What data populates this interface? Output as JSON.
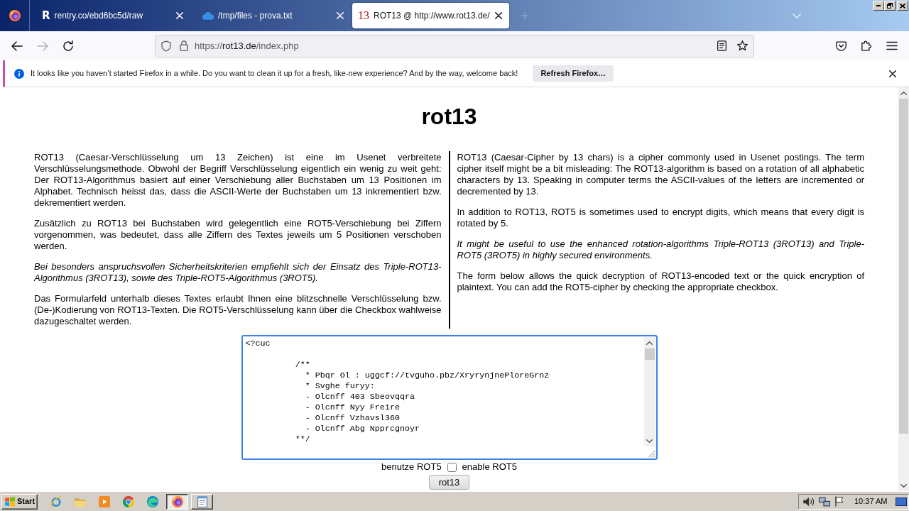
{
  "browser_tabs": [
    {
      "kind": "rentry",
      "favicon": "R",
      "title": "rentry.co/ebd6bc5d/raw",
      "selected": false
    },
    {
      "kind": "cloud",
      "title": "/tmp/files - prova.txt",
      "selected": false
    },
    {
      "kind": "rot13",
      "favicon": "13",
      "title": "ROT13 @ http://www.rot13.de/",
      "selected": true
    }
  ],
  "navigation": {
    "back": {
      "disabled": false
    },
    "forward": {
      "disabled": true
    }
  },
  "address_bar": {
    "scheme": "https://",
    "host": "rot13.de",
    "path": "/index.php"
  },
  "notification": {
    "message": "It looks like you haven’t started Firefox in a while. Do you want to clean it up for a fresh, like-new experience? And by the way, welcome back!",
    "button": "Refresh Firefox…"
  },
  "page": {
    "title": "rot13",
    "columns": [
      {
        "paragraphs": [
          {
            "text": "ROT13 (Caesar-Verschlüsselung um 13 Zeichen) ist eine im Usenet verbreitete Verschlüsselungsmethode. Obwohl der Begriff Verschlüsselung eigentlich ein wenig zu weit geht: Der ROT13-Algorithmus basiert auf einer Verschiebung aller Buchstaben um 13 Positionen im Alphabet. Technisch heisst das, dass die ASCII-Werte der Buchstaben um 13 inkrementiert bzw. dekrementiert werden.",
            "italic": false
          },
          {
            "text": "Zusätzlich zu ROT13 bei Buchstaben wird gelegentlich eine ROT5-Verschiebung bei Ziffern vorgenommen, was bedeutet, dass alle Ziffern des Textes jeweils um 5 Positionen verschoben werden.",
            "italic": false
          },
          {
            "text": "Bei besonders anspruchsvollen Sicherheitskriterien empfiehlt sich der Einsatz des Triple-ROT13-Algorithmus (3ROT13), sowie des Triple-ROT5-Algorithmus (3ROT5).",
            "italic": true
          },
          {
            "text": "Das Formularfeld unterhalb dieses Textes erlaubt Ihnen eine blitzschnelle Verschlüsselung bzw. (De-)Kodierung von ROT13-Texten. Die ROT5-Verschlüsselung kann über die Checkbox wahlweise dazugeschaltet werden.",
            "italic": false
          }
        ]
      },
      {
        "paragraphs": [
          {
            "text": "ROT13 (Caesar-Cipher by 13 chars) is a cipher commonly used in Usenet postings. The term cipher itself might be a bit misleading: The ROT13-algorithm is based on a rotation of all alphabetic characters by 13. Speaking in computer terms the ASCII-values of the letters are incremented or decremented by 13.",
            "italic": false
          },
          {
            "text": "In addition to ROT13, ROT5 is sometimes used to encrypt digits, which means that every digit is rotated by 5.",
            "italic": false
          },
          {
            "text": "It might be useful to use the enhanced rotation-algorithms Triple-ROT13 (3ROT13) and Triple-ROT5 (3ROT5) in highly secured environments.",
            "italic": true
          },
          {
            "text": "The form below allows the quick decryption of ROT13-encoded text or the quick encryption of plaintext. You can add the ROT5-cipher by checking the appropriate checkbox.",
            "italic": false
          }
        ]
      }
    ],
    "form": {
      "textarea": {
        "value": "<?cuc\n\n          /**\n            * Pbqr Ol : uggcf://tvguho.pbz/XryrynjnePloreGrnz\n            * Svghe furyy:\n            - Olcnff 403 Sbeovqqra\n            - Olcnff Nyy Freire\n            - Olcnff Vzhavsl360\n            - Olcnff Abg Npprcgnoyr\n          **/",
        "focused": true
      },
      "rot5_checkbox": {
        "label_before": "benutze ROT5",
        "label_after": "enable ROT5",
        "checked": false
      },
      "submit_button": "rot13"
    }
  },
  "taskbar": {
    "start": "Start",
    "tasks": [
      {
        "kind": "firefox",
        "selected": true
      },
      {
        "kind": "notepad",
        "selected": false
      }
    ],
    "clock": "10:37 AM"
  }
}
